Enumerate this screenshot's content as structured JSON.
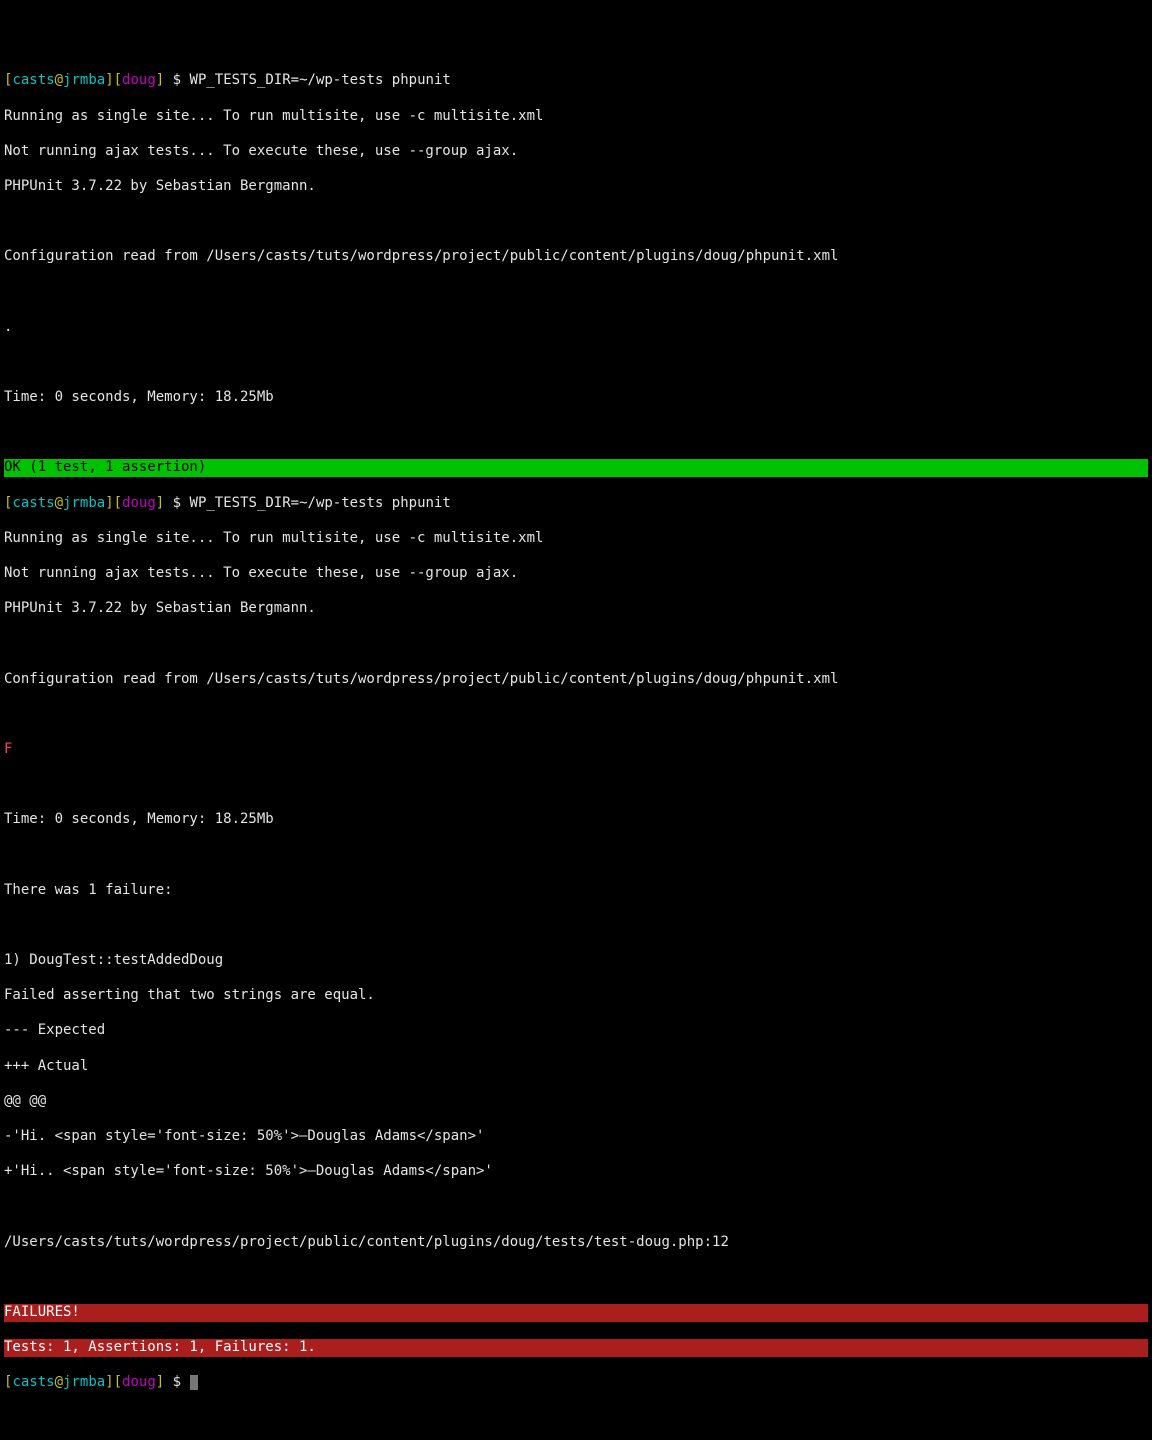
{
  "prompt": {
    "user": "casts",
    "host": "jrmba",
    "dir": "doug",
    "sigil": "$",
    "cmd": "WP_TESTS_DIR=~/wp-tests phpunit"
  },
  "preamble": {
    "single_site": "Running as single site... To run multisite, use -c multisite.xml",
    "ajax": "Not running ajax tests... To execute these, use --group ajax.",
    "version": "PHPUnit 3.7.22 by Sebastian Bergmann.",
    "config": "Configuration read from /Users/casts/tuts/wordpress/project/public/content/plugins/doug/phpunit.xml"
  },
  "run1": {
    "progress": ".",
    "time": "Time: 0 seconds, Memory: 18.25Mb",
    "ok": "OK (1 test, 1 assertion)"
  },
  "run2": {
    "progress": "F",
    "time": "Time: 0 seconds, Memory: 18.25Mb",
    "fail_header": "There was 1 failure:",
    "test_name": "1) DougTest::testAddedDoug",
    "assert_msg": "Failed asserting that two strings are equal.",
    "diff_expected": "--- Expected",
    "diff_actual": "+++ Actual",
    "diff_hunk": "@@ @@",
    "diff_minus": "-'Hi. <span style='font-size: 50%'>—Douglas Adams</span>'",
    "diff_plus": "+'Hi.. <span style='font-size: 50%'>—Douglas Adams</span>'",
    "trace": "/Users/casts/tuts/wordpress/project/public/content/plugins/doug/tests/test-doug.php:12",
    "fail_banner": "FAILURES!",
    "fail_stats": "Tests: 1, Assertions: 1, Failures: 1."
  }
}
